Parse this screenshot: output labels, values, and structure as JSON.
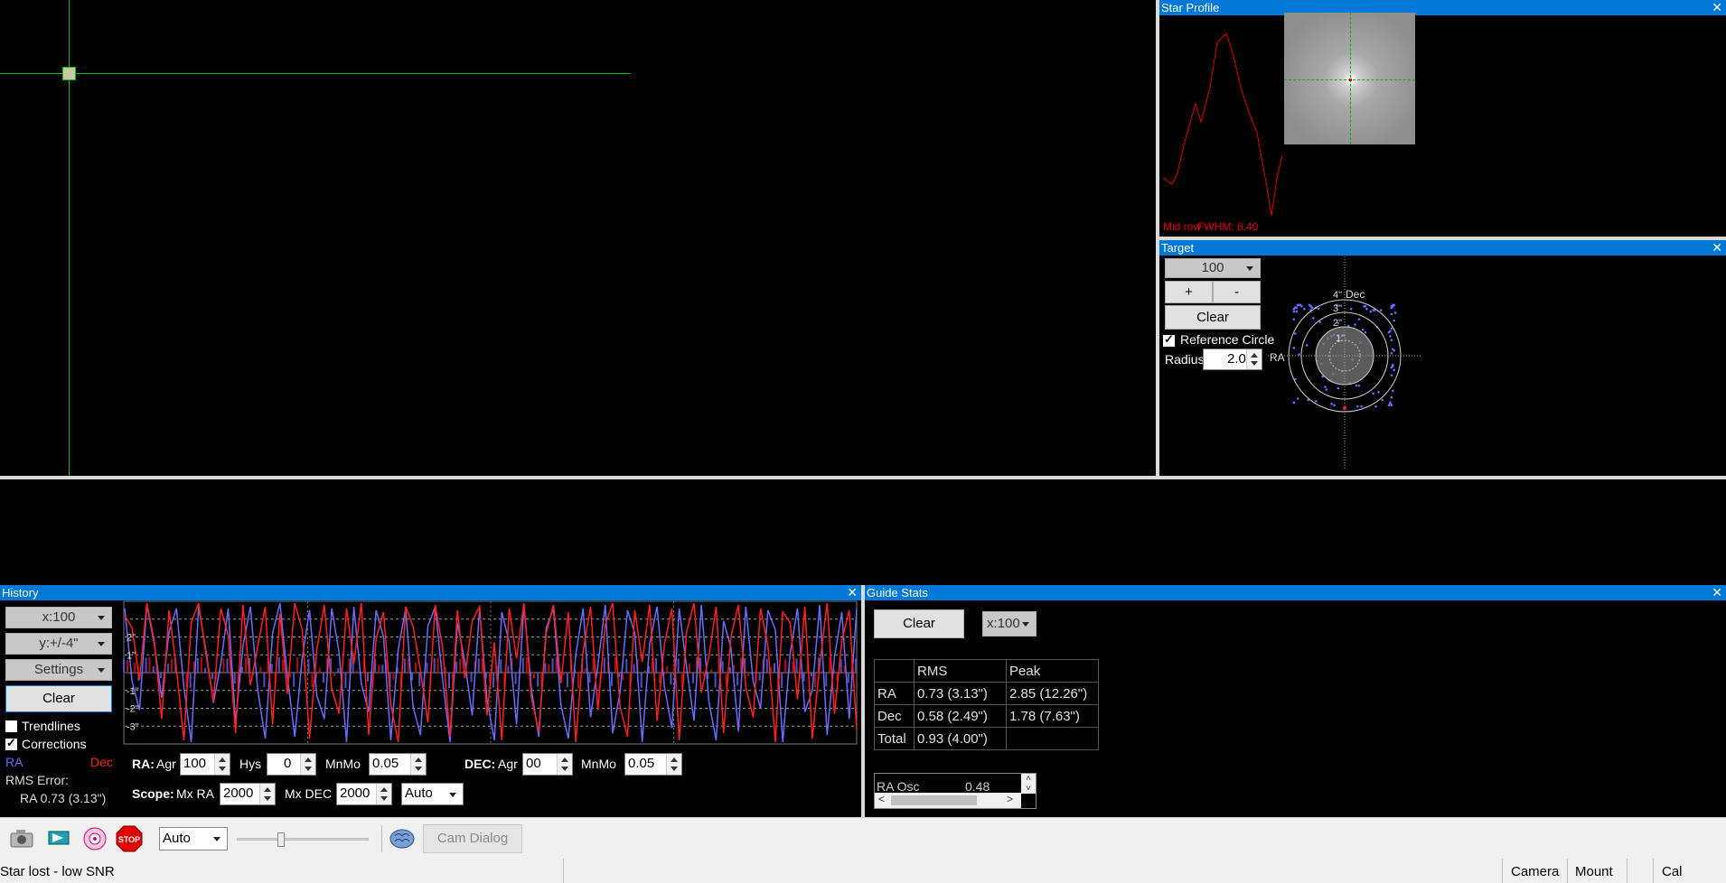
{
  "star_profile": {
    "title": "Star Profile",
    "close": "✕",
    "label_mid": "Mid row",
    "label_fwhm": "FWHM: 8.40"
  },
  "target": {
    "title": "Target",
    "close": "✕",
    "scale_value": "100",
    "plus_label": "+",
    "minus_label": "-",
    "clear_label": "Clear",
    "ref_circle_label": "Reference Circle",
    "ref_circle_checked": true,
    "radius_label": "Radius:",
    "radius_value": "2.0",
    "ring_labels": [
      "4\"",
      "3\"",
      "2\"",
      "1\""
    ],
    "axis_dec": "Dec",
    "axis_ra": "RA"
  },
  "history": {
    "title": "History",
    "close": "✕",
    "x_scale": "x:100",
    "y_scale": "y:+/-4\"",
    "settings_label": "Settings",
    "clear_label": "Clear",
    "trendlines_label": "Trendlines",
    "trendlines_checked": false,
    "corrections_label": "Corrections",
    "corrections_checked": true,
    "legend_ra": "RA",
    "legend_dec": "Dec",
    "rms_error_label": "RMS Error:",
    "rms_ra_text": "RA 0.73 (3.13\")",
    "y_tick_labels": [
      "2\"",
      "1\"",
      "-1\"",
      "-2\"",
      "-3\""
    ],
    "ra_agr_label": "RA:",
    "agr_label": "Agr",
    "ra_agr_value": "100",
    "hys_label": "Hys",
    "hys_value": "0",
    "mnmo_label": "MnMo",
    "ra_mnmo_value": "0.05",
    "dec_label": "DEC:",
    "dec_agr_value": "00",
    "dec_mnmo_value": "0.05",
    "scope_label": "Scope:",
    "mx_ra_label": "Mx RA",
    "mx_ra_value": "2000",
    "mx_dec_label": "Mx DEC",
    "mx_dec_value": "2000",
    "dec_mode_value": "Auto"
  },
  "guide_stats": {
    "title": "Guide Stats",
    "close": "✕",
    "clear_label": "Clear",
    "x_scale": "x:100",
    "headers": [
      "",
      "RMS",
      "Peak"
    ],
    "rows": [
      [
        "RA",
        "0.73 (3.13\")",
        "2.85 (12.26\")"
      ],
      [
        "Dec",
        "0.58 (2.49\")",
        "1.78 (7.63\")"
      ],
      [
        "Total",
        "0.93 (4.00\")",
        ""
      ]
    ],
    "osc_label": "RA Osc",
    "osc_value": "0.48"
  },
  "toolbar": {
    "exposure_value": "Auto",
    "cam_dialog_label": "Cam Dialog"
  },
  "status_bar": {
    "message": "Star lost - low SNR",
    "camera": "Camera",
    "mount": "Mount",
    "cal": "Cal"
  },
  "colors": {
    "ra": "#6b6bff",
    "dec": "#ff2020",
    "crosshair": "#00c000",
    "titlebar": "#0078d7"
  },
  "chart_data": {
    "type": "line",
    "y_range": [
      -4,
      4
    ],
    "x_count": 100,
    "y_tick_values": [
      2,
      1,
      -1,
      -2,
      -3
    ],
    "series": [
      {
        "name": "RA",
        "values": [
          3.6,
          -0.5,
          -2.1,
          3.8,
          1.6,
          -1.4,
          2.3,
          3.6,
          -0.8,
          -3.9,
          3.7,
          1.2,
          -1.7,
          0.5,
          3.6,
          -2.8,
          1.5,
          3.7,
          -1.0,
          -3.7,
          2.2,
          3.9,
          -0.2,
          -3.6,
          0.8,
          3.5,
          -1.3,
          -2.6,
          3.6,
          1.1,
          -3.9,
          3.7,
          -0.6,
          -2.2,
          3.5,
          2.0,
          -3.8,
          1.3,
          3.6,
          -1.9,
          -3.5,
          2.6,
          3.7,
          -0.4,
          -3.9,
          2.8,
          0.6,
          -2.4,
          3.6,
          -1.5,
          -3.8,
          3.4,
          1.7,
          -2.9,
          3.8,
          -0.9,
          -3.6,
          2.5,
          3.6,
          -1.8,
          -3.7,
          1.0,
          3.6,
          -2.5,
          0.4,
          3.8,
          -3.4,
          -1.1,
          3.5,
          2.2,
          -3.9,
          1.6,
          3.7,
          -0.8,
          -3.1,
          3.6,
          0.3,
          -2.7,
          3.8,
          -1.6,
          -3.8,
          2.9,
          1.4,
          -3.3,
          3.7,
          -0.5,
          -2.0,
          3.5,
          2.4,
          -3.9,
          1.1,
          3.6,
          -2.2,
          -1.0,
          3.8,
          -3.5,
          0.9,
          3.4,
          -2.6,
          3.6
        ]
      },
      {
        "name": "Dec",
        "values": [
          3.2,
          2.5,
          -0.4,
          3.9,
          1.8,
          -2.6,
          3.5,
          0.2,
          -3.8,
          2.8,
          3.9,
          1.0,
          -1.6,
          3.6,
          2.1,
          -3.4,
          3.8,
          -0.7,
          1.5,
          3.7,
          -2.9,
          3.3,
          -1.2,
          3.9,
          2.4,
          -3.7,
          1.3,
          3.8,
          -0.9,
          -2.3,
          3.6,
          0.5,
          3.9,
          -3.5,
          1.9,
          3.4,
          -1.8,
          -3.9,
          3.7,
          2.6,
          0.1,
          -2.8,
          3.8,
          1.4,
          -3.6,
          3.5,
          -0.3,
          2.9,
          3.7,
          -2.4,
          1.7,
          -3.8,
          3.6,
          0.8,
          3.9,
          -1.4,
          -3.3,
          2.2,
          3.8,
          -0.6,
          3.4,
          -3.9,
          1.2,
          3.7,
          -2.1,
          2.7,
          3.9,
          -1.9,
          -3.6,
          3.5,
          0.6,
          3.8,
          -2.7,
          1.6,
          3.6,
          -3.8,
          2.3,
          3.9,
          -1.1,
          0.9,
          3.7,
          -3.4,
          2.0,
          3.8,
          -0.8,
          -2.5,
          3.6,
          1.5,
          -3.9,
          3.4,
          2.8,
          -1.5,
          3.7,
          -3.7,
          0.4,
          3.9,
          -2.3,
          1.8,
          3.5,
          -3.2
        ]
      }
    ]
  }
}
